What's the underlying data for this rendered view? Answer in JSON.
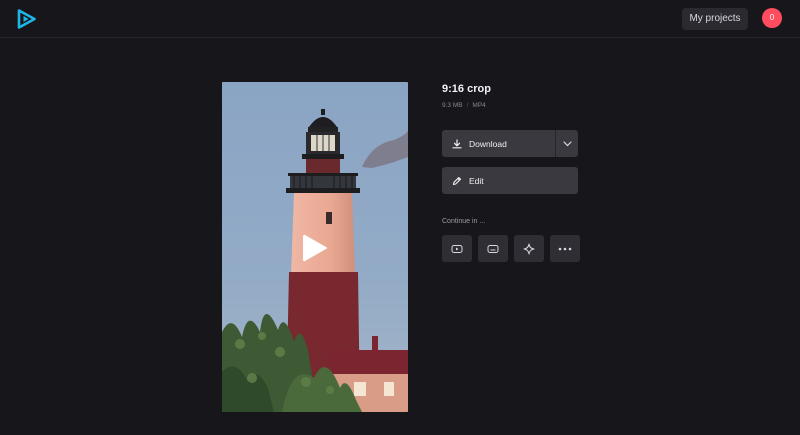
{
  "header": {
    "my_projects_label": "My projects",
    "avatar_count": "0",
    "avatar_color": "#ff4c5f",
    "logo_icon": "play-logo-icon"
  },
  "video": {
    "title": "9:16 crop",
    "size": "9.3 MB",
    "format": "MP4",
    "play_icon": "play-icon"
  },
  "actions": {
    "download_label": "Download",
    "edit_label": "Edit",
    "continue_label": "Continue in ..."
  },
  "continue_tools": [
    {
      "name": "youtube",
      "icon": "video-player-icon"
    },
    {
      "name": "subtitles",
      "icon": "subtitles-icon"
    },
    {
      "name": "effects",
      "icon": "sparkle-icon"
    },
    {
      "name": "more",
      "icon": "more-dots-icon"
    }
  ],
  "colors": {
    "background": "#17171b",
    "button": "#39393f",
    "accent": "#1fb6e6"
  }
}
